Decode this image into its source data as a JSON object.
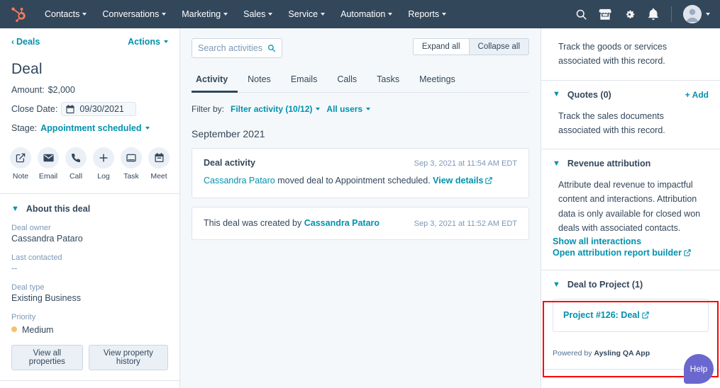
{
  "topnav": {
    "logo": "hubspot-logo",
    "menus": [
      {
        "label": "Contacts"
      },
      {
        "label": "Conversations"
      },
      {
        "label": "Marketing"
      },
      {
        "label": "Sales"
      },
      {
        "label": "Service"
      },
      {
        "label": "Automation"
      },
      {
        "label": "Reports"
      }
    ],
    "icons": [
      "search-icon",
      "marketplace-icon",
      "settings-gear-icon",
      "notifications-bell-icon"
    ],
    "avatar": "user-avatar"
  },
  "left": {
    "breadcrumb": "Deals",
    "actions_label": "Actions",
    "title": "Deal",
    "amount_label": "Amount:",
    "amount_value": "$2,000",
    "close_date_label": "Close Date:",
    "close_date_value": "09/30/2021",
    "stage_label": "Stage:",
    "stage_value": "Appointment scheduled",
    "quick_actions": [
      {
        "label": "Note",
        "icon": "note-icon"
      },
      {
        "label": "Email",
        "icon": "email-icon"
      },
      {
        "label": "Call",
        "icon": "call-icon"
      },
      {
        "label": "Log",
        "icon": "log-plus-icon"
      },
      {
        "label": "Task",
        "icon": "task-icon"
      },
      {
        "label": "Meet",
        "icon": "meeting-calendar-icon"
      }
    ],
    "about": {
      "title": "About this deal",
      "props": [
        {
          "label": "Deal owner",
          "value": "Cassandra Pataro"
        },
        {
          "label": "Last contacted",
          "value": "--"
        },
        {
          "label": "Deal type",
          "value": "Existing Business"
        }
      ],
      "priority_label": "Priority",
      "priority_value": "Medium",
      "priority_color": "#f5c26b",
      "btn_all_properties": "View all properties",
      "btn_property_history": "View property history"
    }
  },
  "center": {
    "search_placeholder": "Search activities",
    "search_value": "",
    "expand_all": "Expand all",
    "collapse_all": "Collapse all",
    "tabs": [
      {
        "label": "Activity",
        "active": true
      },
      {
        "label": "Notes",
        "active": false
      },
      {
        "label": "Emails",
        "active": false
      },
      {
        "label": "Calls",
        "active": false
      },
      {
        "label": "Tasks",
        "active": false
      },
      {
        "label": "Meetings",
        "active": false
      }
    ],
    "filter_by_label": "Filter by:",
    "filter_activity": "Filter activity (10/12)",
    "filter_users": "All users",
    "month_header": "September 2021",
    "activities": [
      {
        "title": "Deal activity",
        "time": "Sep 3, 2021 at 11:54 AM EDT",
        "actor": "Cassandra Pataro",
        "body_text": " moved deal to Appointment scheduled. ",
        "link": "View details",
        "has_external_icon": true
      },
      {
        "title": "",
        "time": "Sep 3, 2021 at 11:52 AM EDT",
        "prefix": "This deal was created by ",
        "actor": "Cassandra Pataro",
        "body_text": "",
        "link": "",
        "has_external_icon": false
      }
    ]
  },
  "right": {
    "line_items_text": "Track the goods or services associated with this record.",
    "quotes": {
      "title": "Quotes (0)",
      "add_label": "+ Add",
      "text": "Track the sales documents associated with this record."
    },
    "revenue": {
      "title": "Revenue attribution",
      "text": "Attribute deal revenue to impactful content and interactions. Attribution data is only available for closed won deals with associated contacts.",
      "link1": "Show all interactions",
      "link2": "Open attribution report builder"
    },
    "deal_to_project": {
      "title": "Deal to Project (1)",
      "project_link": "Project #126: Deal",
      "powered_prefix": "Powered by ",
      "powered_app": "Aysling QA App",
      "highlight_color": "#ff0000"
    },
    "help_button": "Help"
  }
}
